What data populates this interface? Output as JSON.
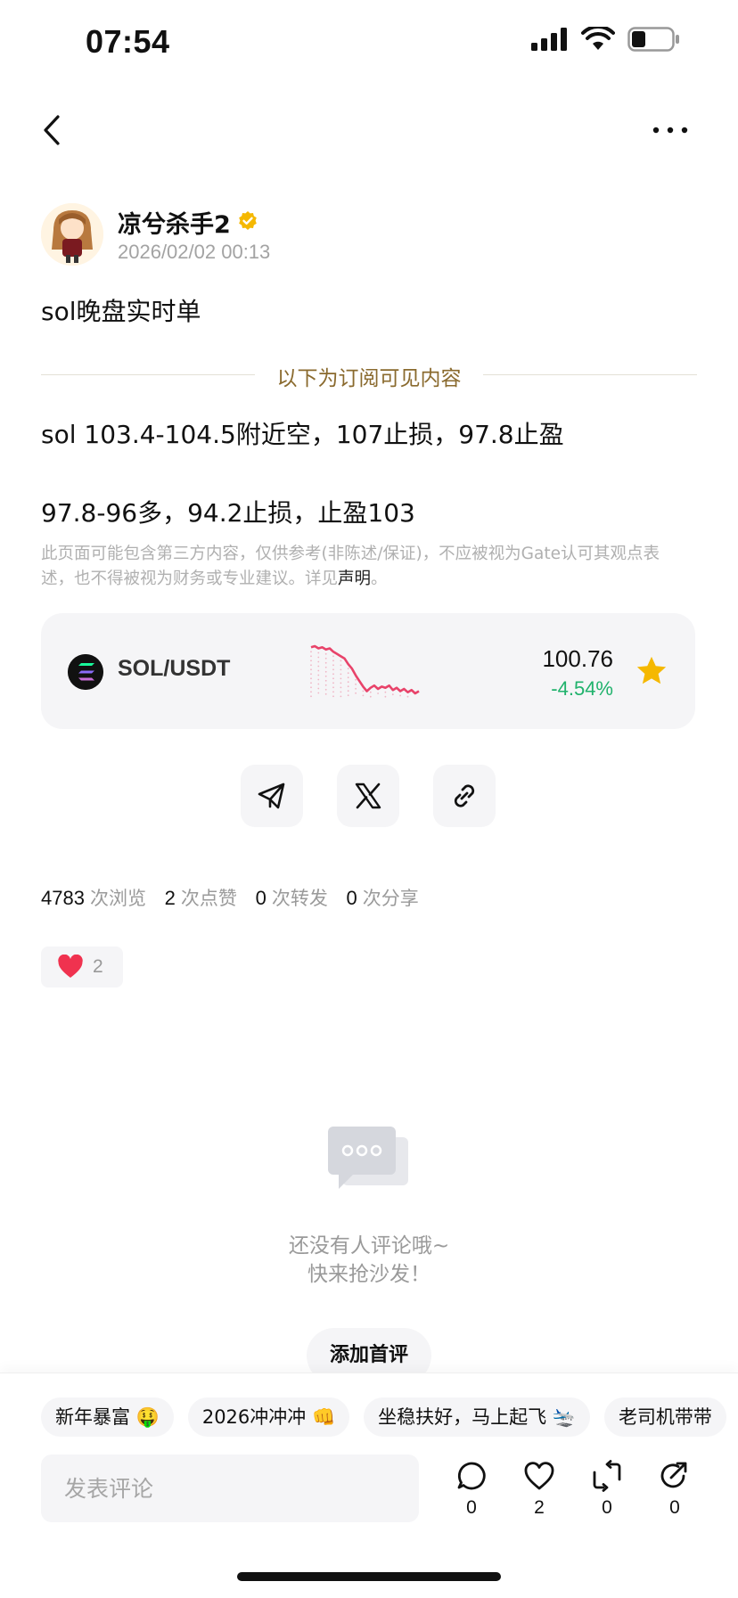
{
  "status_bar": {
    "time": "07:54",
    "battery_level": 0.35
  },
  "author": {
    "name": "凉兮杀手2",
    "date": "2026/02/02 00:13",
    "verified": true
  },
  "post": {
    "title": "sol晚盘实时单",
    "subscriber_divider": "以下为订阅可见内容",
    "lines": [
      "sol 103.4-104.5附近空，107止损，97.8止盈",
      "97.8-96多，94.2止损，止盈103"
    ],
    "disclaimer": "此页面可能包含第三方内容，仅供参考(非陈述/保证)，不应被视为Gate认可其观点表述，也不得被视为财务或专业建议。详见",
    "disclaimer_link": "声明",
    "disclaimer_end": "。"
  },
  "ticker": {
    "pair": "SOL/USDT",
    "price": "100.76",
    "change": "-4.54%",
    "change_color": "#20b26c",
    "sparkline_color": "#e8436a",
    "sparkline": [
      104.5,
      104.6,
      104.4,
      104.5,
      104.3,
      104.4,
      104.1,
      103.9,
      103.7,
      103.5,
      103.0,
      102.6,
      102.0,
      101.5,
      101.0,
      100.6,
      100.9,
      101.1,
      100.8,
      101.0,
      100.9,
      101.1,
      100.7,
      100.9,
      100.6,
      100.8,
      100.5,
      100.7,
      100.4,
      100.6
    ]
  },
  "share_buttons": [
    {
      "icon": "telegram-icon"
    },
    {
      "icon": "x-icon"
    },
    {
      "icon": "link-icon"
    }
  ],
  "stats": {
    "views_count": "4783",
    "views_label": "次浏览",
    "likes_count": "2",
    "likes_label": "次点赞",
    "reposts_count": "0",
    "reposts_label": "次转发",
    "shares_count": "0",
    "shares_label": "次分享"
  },
  "reaction": {
    "icon": "heart-icon",
    "count": "2"
  },
  "comments": {
    "empty_line1": "还没有人评论哦~",
    "empty_line2": "快来抢沙发！",
    "first_comment_button": "添加首评"
  },
  "quick_replies": [
    "新年暴富 🤑",
    "2026冲冲冲 👊",
    "坐稳扶好，马上起飞 🛬",
    "老司机带带"
  ],
  "comment_box": {
    "placeholder": "发表评论"
  },
  "actions": {
    "comment": "0",
    "like": "2",
    "repost": "0",
    "share": "0"
  },
  "colors": {
    "accent_gold": "#8a6a2e",
    "verified_badge": "#f5b800",
    "star": "#f5b800",
    "heart": "#f0324f"
  }
}
